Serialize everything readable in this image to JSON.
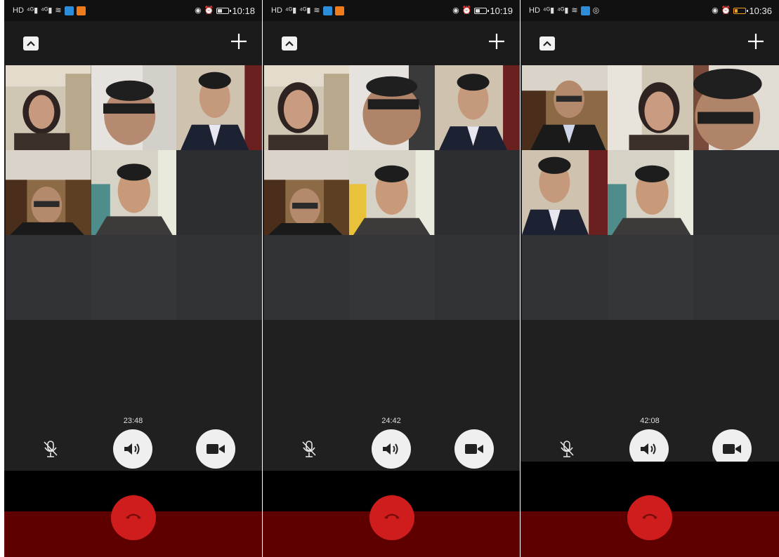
{
  "screens": [
    {
      "status": {
        "time": "10:18"
      },
      "call": {
        "timer": "23:48"
      }
    },
    {
      "status": {
        "time": "10:19"
      },
      "call": {
        "timer": "24:42"
      }
    },
    {
      "status": {
        "time": "10:36"
      },
      "call": {
        "timer": "42:08"
      }
    }
  ],
  "icons": {
    "collapse": "chevron-up-icon",
    "add": "plus-icon",
    "mic": "microphone-muted-icon",
    "speaker": "speaker-icon",
    "camera": "video-camera-icon",
    "end": "hang-up-icon"
  },
  "colors": {
    "bar": "#1b1b1b",
    "background": "#202020",
    "control_bg": "#efefef",
    "end_call": "#cf1d1d"
  }
}
